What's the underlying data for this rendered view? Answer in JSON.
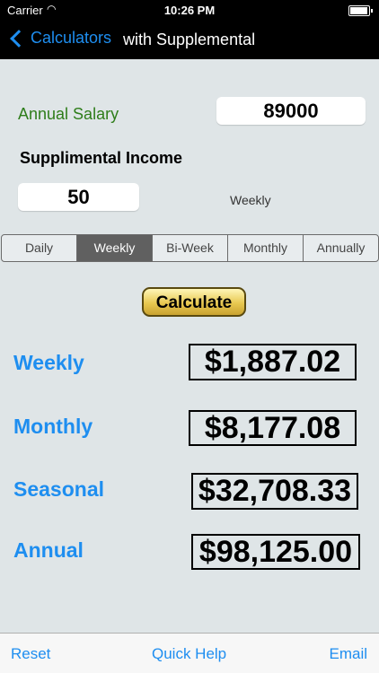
{
  "status_bar": {
    "carrier": "Carrier",
    "time": "10:26 PM"
  },
  "nav": {
    "back_label": "Calculators",
    "title": "with Supplemental"
  },
  "form": {
    "salary_label": "Annual Salary",
    "salary_value": "89000",
    "supplemental_label": "Supplimental Income",
    "supplemental_value": "50",
    "frequency_label": "Weekly"
  },
  "segments": {
    "items": [
      "Daily",
      "Weekly",
      "Bi-Week",
      "Monthly",
      "Annually"
    ],
    "selected": "Weekly"
  },
  "calculate_label": "Calculate",
  "results": [
    {
      "label": "Weekly",
      "value": "$1,887.02"
    },
    {
      "label": "Monthly",
      "value": "$8,177.08"
    },
    {
      "label": "Seasonal",
      "value": "$32,708.33"
    },
    {
      "label": "Annual",
      "value": "$98,125.00"
    }
  ],
  "toolbar": {
    "reset": "Reset",
    "help": "Quick Help",
    "email": "Email"
  },
  "colors": {
    "accent": "#1e8ef0",
    "salary_label": "#2e7d1a",
    "nav_bg": "#000000",
    "selected_segment": "#606060"
  },
  "icons": {
    "wifi": "wifi-icon",
    "battery": "battery-icon",
    "back": "chevron-left-icon"
  }
}
